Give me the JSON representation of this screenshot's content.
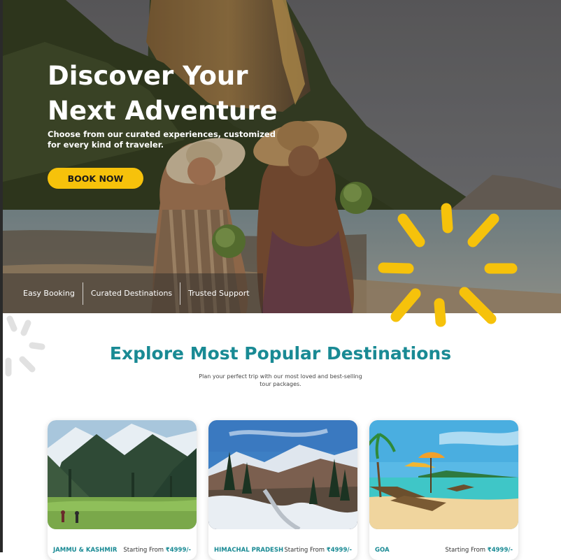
{
  "hero": {
    "title": "Discover Your Next Adventure",
    "subtitle": "Choose from our curated experiences, customized for every kind of traveler.",
    "cta_label": "BOOK NOW",
    "features": [
      "Easy Booking",
      "Curated Destinations",
      "Trusted Support"
    ]
  },
  "popular": {
    "title": "Explore Most Popular Destinations",
    "subtitle": "Plan your perfect trip with our most loved and best-selling tour packages.",
    "cards": [
      {
        "name": "JAMMU & KASHMIR",
        "price_label": "Starting From",
        "price": "₹4999/-"
      },
      {
        "name": "HIMACHAL PRADESH",
        "price_label": "Starting From",
        "price": "₹4999/-"
      },
      {
        "name": "GOA",
        "price_label": "Starting From",
        "price": "₹4999/-"
      }
    ]
  },
  "colors": {
    "accent": "#198a94",
    "cta": "#f6c20b",
    "burst": "#f6c20b"
  }
}
